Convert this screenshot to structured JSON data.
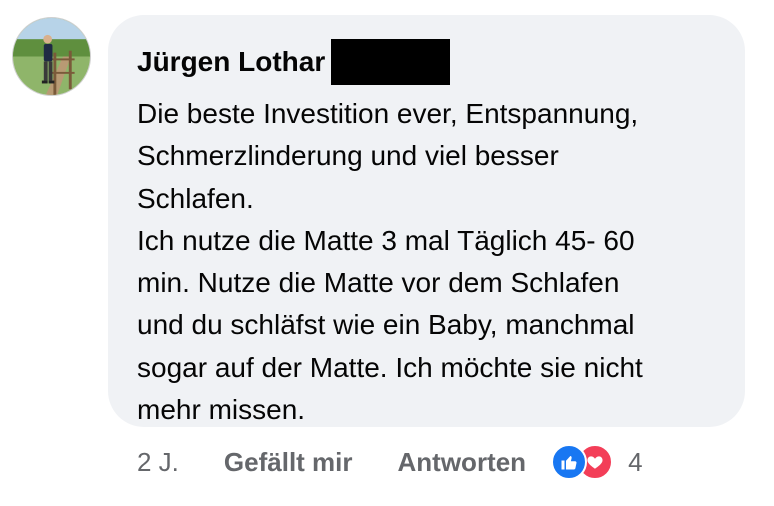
{
  "comment": {
    "author": "Jürgen Lothar",
    "text_lines": [
      "Die beste Investition ever, Entspannung,",
      "Schmerzlinderung und viel besser",
      "Schlafen.",
      "Ich nutze die Matte 3 mal Täglich 45- 60",
      "min. Nutze die Matte vor dem Schlafen",
      "und du schläfst wie ein Baby, manchmal",
      "sogar auf der Matte. Ich möchte sie nicht",
      "mehr missen."
    ]
  },
  "actions": {
    "timestamp": "2 J.",
    "like_label": "Gefällt mir",
    "reply_label": "Antworten",
    "reaction_count": "4",
    "reaction_icons": [
      "like-icon",
      "love-icon"
    ]
  },
  "colors": {
    "bubble_bg": "#f0f2f5",
    "text": "#050505",
    "meta": "#65676b",
    "like_blue": "#1877f2",
    "love_red": "#f33e58"
  }
}
